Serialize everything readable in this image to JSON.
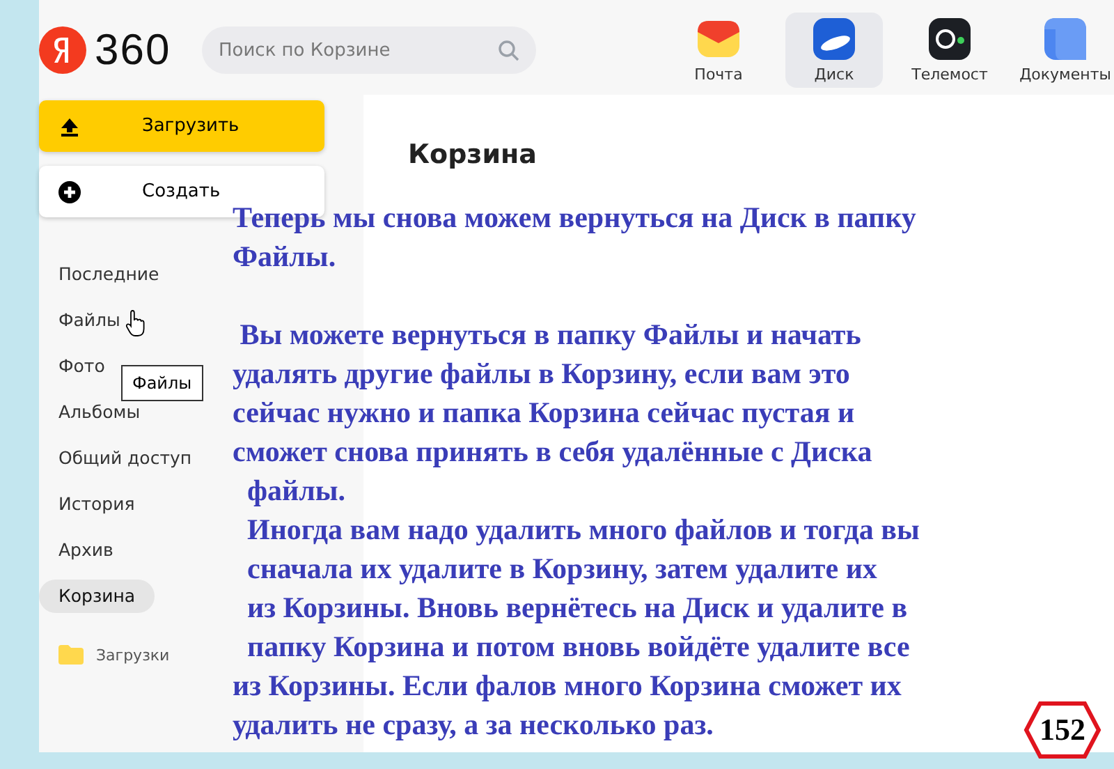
{
  "header": {
    "logo": "360",
    "search": {
      "placeholder": "Поиск по Корзине"
    },
    "services": [
      {
        "label": "Почта",
        "kind": "mail",
        "selected": false
      },
      {
        "label": "Диск",
        "kind": "disk",
        "selected": true
      },
      {
        "label": "Телемост",
        "kind": "telemost",
        "selected": false
      },
      {
        "label": "Документы",
        "kind": "docs",
        "selected": false
      }
    ]
  },
  "sidebar": {
    "buttons": [
      {
        "label": "Загрузить",
        "kind": "upload"
      },
      {
        "label": "Создать",
        "kind": "create"
      }
    ],
    "items": [
      {
        "label": "Последние",
        "selected": false
      },
      {
        "label": "Файлы",
        "selected": false
      },
      {
        "label": "Фото",
        "selected": false
      },
      {
        "label": "Альбомы",
        "selected": false
      },
      {
        "label": "Общий доступ",
        "selected": false
      },
      {
        "label": "История",
        "selected": false
      },
      {
        "label": "Архив",
        "selected": false
      },
      {
        "label": "Корзина",
        "selected": true
      }
    ],
    "folders": [
      {
        "label": "Загрузки"
      }
    ],
    "tooltip": "Файлы"
  },
  "main": {
    "title": "Корзина"
  },
  "annotation": {
    "paragraphs": [
      [
        "Теперь мы снова можем вернуться на Диск в папку",
        "Файлы."
      ],
      [
        " Вы можете вернуться в папку Файлы и начать",
        "удалять другие файлы в Корзину, если вам это",
        "сейчас нужно и папка Корзина сейчас пустая и",
        "сможет снова принять в себя удалённые с Диска",
        "  файлы.",
        "  Иногда вам надо удалить много файлов и тогда вы",
        "  сначала их удалите в Корзину, затем удалите их",
        "  из Корзины. Вновь вернётесь на Диск и удалите в",
        "  папку Корзина и потом вновь войдёте удалите все",
        "из Корзины. Если фалов много Корзина сможет их",
        "удалить не сразу, а за несколько раз."
      ]
    ],
    "page_number": "152"
  }
}
